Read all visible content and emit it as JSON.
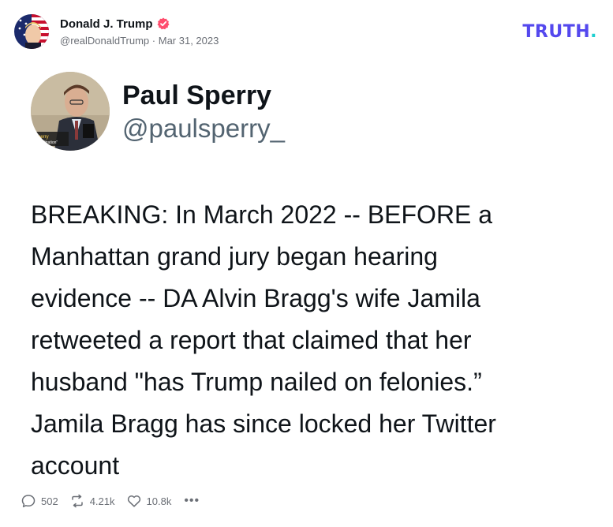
{
  "colors": {
    "brand": "#5448ee",
    "brand_accent": "#1ccfd0",
    "verified_badge": "#ff4d6d",
    "muted_text": "#6b6f76",
    "primary_text": "#0f1419"
  },
  "post": {
    "author_name": "Donald J. Trump",
    "handle": "@realDonaldTrump",
    "separator": "·",
    "date": "Mar 31, 2023",
    "verified_icon": "verified-badge-icon"
  },
  "brand": {
    "logo_text": "TRUTH",
    "logo_dot": "."
  },
  "embedded": {
    "author_name": "Paul Sperry",
    "handle": "@paulsperry_",
    "text": "BREAKING: In March 2022 -- BEFORE a\nManhattan grand jury began hearing\nevidence -- DA Alvin Bragg's wife Jamila\nretweeted a report that claimed that her\nhusband \"has Trump nailed on felonies.”\nJamila Bragg has since locked her Twitter\naccount",
    "avatar_caption_line1": "l Sperry",
    "avatar_caption_line2": "or, \"Infiltration\""
  },
  "actions": {
    "replies": "502",
    "retruths": "4.21k",
    "likes": "10.8k",
    "more_label": "•••",
    "icons": [
      "reply-icon",
      "retruth-icon",
      "like-icon",
      "more-icon"
    ]
  }
}
